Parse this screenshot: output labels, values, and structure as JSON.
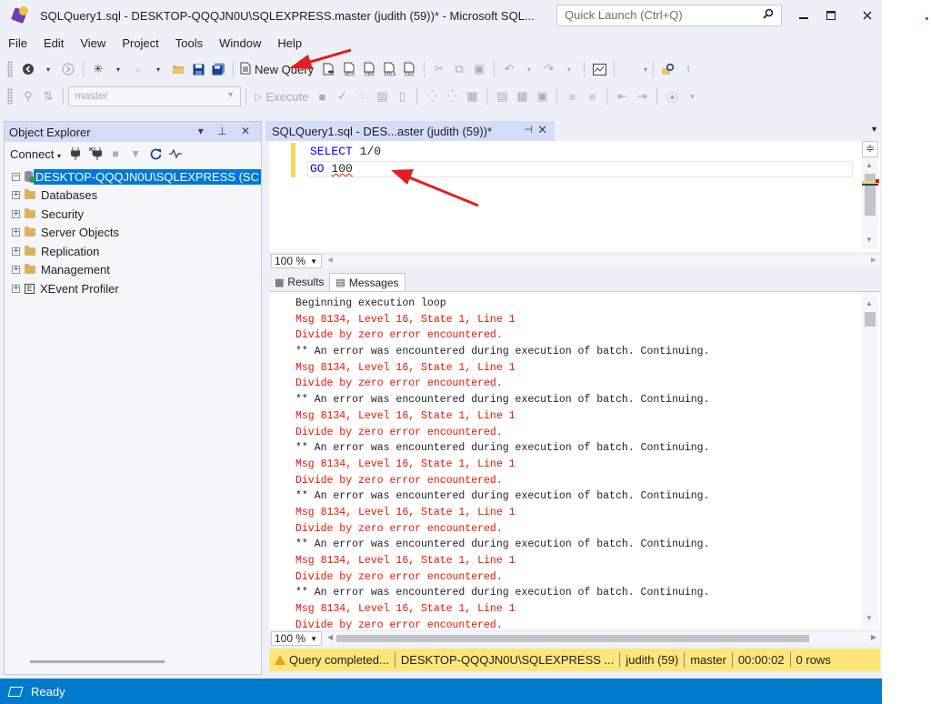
{
  "window": {
    "title": "SQLQuery1.sql - DESKTOP-QQQJN0U\\SQLEXPRESS.master (judith (59))* - Microsoft SQL...",
    "quick_launch_placeholder": "Quick Launch (Ctrl+Q)"
  },
  "menu": [
    "File",
    "Edit",
    "View",
    "Project",
    "Tools",
    "Window",
    "Help"
  ],
  "toolbar": {
    "new_query_label": "New Query",
    "database_select": "master",
    "execute_label": "Execute"
  },
  "object_explorer": {
    "title": "Object Explorer",
    "connect_label": "Connect",
    "server": "DESKTOP-QQQJN0U\\SQLEXPRESS (SC",
    "nodes": [
      "Databases",
      "Security",
      "Server Objects",
      "Replication",
      "Management",
      "XEvent Profiler"
    ]
  },
  "editor": {
    "tab_title": "SQLQuery1.sql - DES...aster (judith (59))*",
    "code_lines": [
      {
        "keyword": "SELECT",
        "rest": " 1/0"
      },
      {
        "keyword": "GO",
        "rest": "100"
      }
    ],
    "zoom": "100 %"
  },
  "results": {
    "tabs": [
      "Results",
      "Messages"
    ],
    "lines": [
      {
        "text": "Beginning execution loop",
        "error": false
      },
      {
        "text": "Msg 8134, Level 16, State 1, Line 1",
        "error": true
      },
      {
        "text": "Divide by zero error encountered.",
        "error": true
      },
      {
        "text": "** An error was encountered during execution of batch. Continuing.",
        "error": false
      },
      {
        "text": "Msg 8134, Level 16, State 1, Line 1",
        "error": true
      },
      {
        "text": "Divide by zero error encountered.",
        "error": true
      },
      {
        "text": "** An error was encountered during execution of batch. Continuing.",
        "error": false
      },
      {
        "text": "Msg 8134, Level 16, State 1, Line 1",
        "error": true
      },
      {
        "text": "Divide by zero error encountered.",
        "error": true
      },
      {
        "text": "** An error was encountered during execution of batch. Continuing.",
        "error": false
      },
      {
        "text": "Msg 8134, Level 16, State 1, Line 1",
        "error": true
      },
      {
        "text": "Divide by zero error encountered.",
        "error": true
      },
      {
        "text": "** An error was encountered during execution of batch. Continuing.",
        "error": false
      },
      {
        "text": "Msg 8134, Level 16, State 1, Line 1",
        "error": true
      },
      {
        "text": "Divide by zero error encountered.",
        "error": true
      },
      {
        "text": "** An error was encountered during execution of batch. Continuing.",
        "error": false
      },
      {
        "text": "Msg 8134, Level 16, State 1, Line 1",
        "error": true
      },
      {
        "text": "Divide by zero error encountered.",
        "error": true
      },
      {
        "text": "** An error was encountered during execution of batch. Continuing.",
        "error": false
      },
      {
        "text": "Msg 8134, Level 16, State 1, Line 1",
        "error": true
      },
      {
        "text": "Divide by zero error encountered.",
        "error": true
      }
    ],
    "zoom": "100 %"
  },
  "query_status": {
    "message": "Query completed...",
    "server": "DESKTOP-QQQJN0U\\SQLEXPRESS ...",
    "user": "judith (59)",
    "database": "master",
    "elapsed": "00:00:02",
    "rows": "0 rows"
  },
  "status_bar": {
    "text": "Ready"
  },
  "colors": {
    "accent_blue": "#007acc",
    "error_red": "#e51400",
    "keyword_blue": "#0000ff",
    "status_yellow": "#ffe67a",
    "annotation_arrow": "#e02020"
  }
}
